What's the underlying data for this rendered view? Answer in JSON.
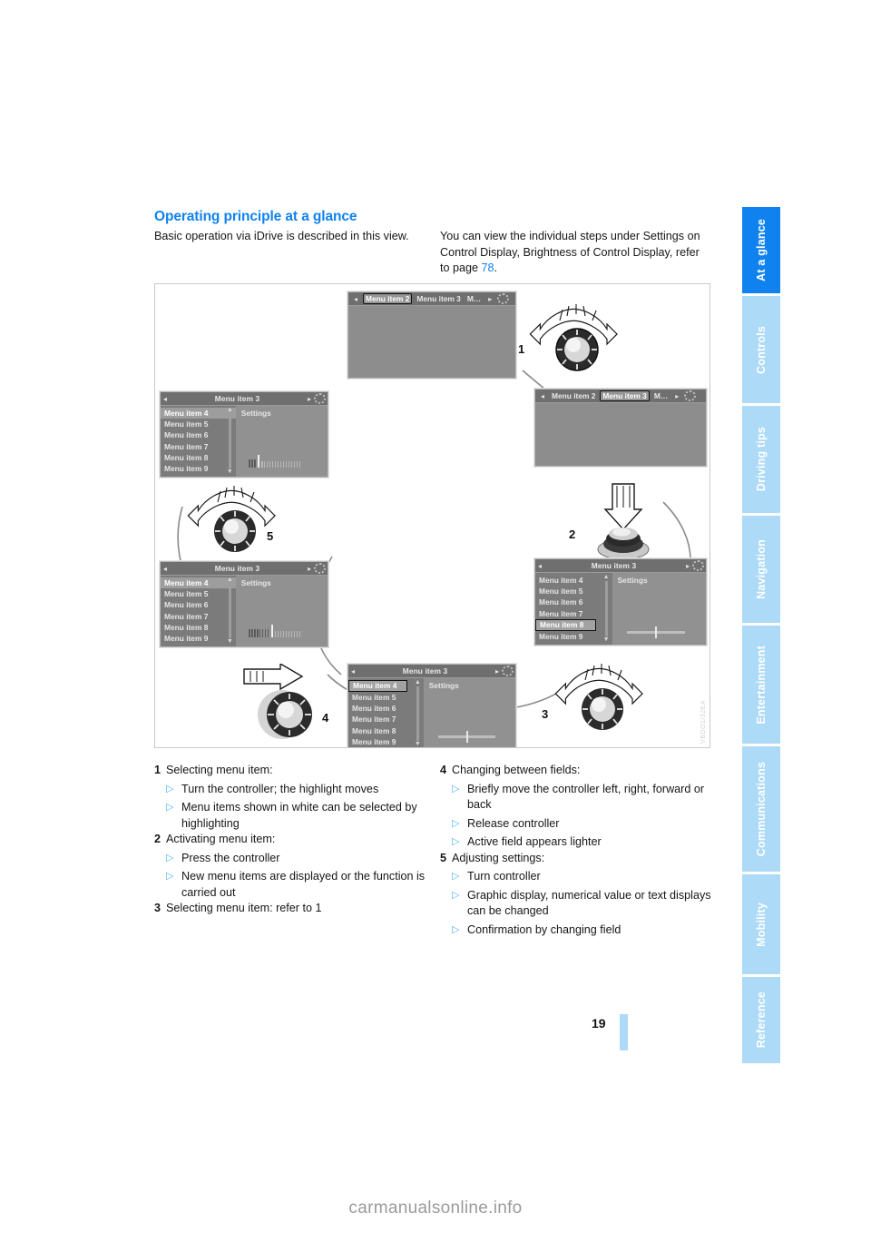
{
  "heading": "Operating principle at a glance",
  "intro": {
    "left": "Basic operation via iDrive is described in this view.",
    "right_before": "You can view the individual steps under Settings on Control Display, Brightness of Control Display, refer to page ",
    "right_page_link": "78",
    "right_after": "."
  },
  "sidebar": {
    "items": [
      {
        "label": "At a glance",
        "active": true
      },
      {
        "label": "Controls",
        "active": false
      },
      {
        "label": "Driving tips",
        "active": false
      },
      {
        "label": "Navigation",
        "active": false
      },
      {
        "label": "Entertainment",
        "active": false
      },
      {
        "label": "Communications",
        "active": false
      },
      {
        "label": "Mobility",
        "active": false
      },
      {
        "label": "Reference",
        "active": false
      }
    ],
    "active_color": "#0f82f0",
    "inactive_color": "#addaf7"
  },
  "figure": {
    "code": "VBDO1/32EA",
    "screens": {
      "top": {
        "tabs": [
          {
            "label": "Menu item 2",
            "selected": true
          },
          {
            "label": "Menu item 3",
            "selected": false
          },
          {
            "label": "M…",
            "selected": false
          }
        ],
        "left_arrow": "◂",
        "right_arrow": "▸"
      },
      "mid_right": {
        "tabs": [
          {
            "label": "Menu item 2",
            "selected": false
          },
          {
            "label": "Menu item 3",
            "selected": true
          },
          {
            "label": "M…",
            "selected": false
          }
        ],
        "left_arrow": "◂",
        "right_arrow": "▸"
      },
      "mid_left": {
        "title": "Menu item 3",
        "left_arrow": "◂",
        "right_arrow": "▸",
        "settings_label": "Settings",
        "items": [
          {
            "label": "Menu item 4",
            "state": "highlight"
          },
          {
            "label": "Menu item 5",
            "state": "normal"
          },
          {
            "label": "Menu item 6",
            "state": "normal"
          },
          {
            "label": "Menu item 7",
            "state": "normal"
          },
          {
            "label": "Menu item 8",
            "state": "normal"
          },
          {
            "label": "Menu item 9",
            "state": "normal"
          }
        ],
        "control": "bars"
      },
      "bottom_left": {
        "title": "Menu item 3",
        "left_arrow": "◂",
        "right_arrow": "▸",
        "settings_label": "Settings",
        "items": [
          {
            "label": "Menu item 4",
            "state": "highlight"
          },
          {
            "label": "Menu item 5",
            "state": "normal"
          },
          {
            "label": "Menu item 6",
            "state": "normal"
          },
          {
            "label": "Menu item 7",
            "state": "normal"
          },
          {
            "label": "Menu item 8",
            "state": "normal"
          },
          {
            "label": "Menu item 9",
            "state": "normal"
          }
        ],
        "control": "bars-high"
      },
      "bottom_right": {
        "title": "Menu item 3",
        "left_arrow": "◂",
        "right_arrow": "▸",
        "settings_label": "Settings",
        "items": [
          {
            "label": "Menu item 4",
            "state": "normal"
          },
          {
            "label": "Menu item 5",
            "state": "normal"
          },
          {
            "label": "Menu item 6",
            "state": "normal"
          },
          {
            "label": "Menu item 7",
            "state": "normal"
          },
          {
            "label": "Menu item 8",
            "state": "boxed"
          },
          {
            "label": "Menu item 9",
            "state": "normal"
          }
        ],
        "control": "slider"
      },
      "bottom_center": {
        "title": "Menu item 3",
        "left_arrow": "◂",
        "right_arrow": "▸",
        "settings_label": "Settings",
        "items": [
          {
            "label": "Menu item 4",
            "state": "boxed"
          },
          {
            "label": "Menu item 5",
            "state": "normal"
          },
          {
            "label": "Menu item 6",
            "state": "normal"
          },
          {
            "label": "Menu item 7",
            "state": "normal"
          },
          {
            "label": "Menu item 8",
            "state": "normal"
          },
          {
            "label": "Menu item 9",
            "state": "normal"
          }
        ],
        "control": "slider"
      }
    },
    "callouts": [
      {
        "number": "1",
        "action": "turn"
      },
      {
        "number": "2",
        "action": "press"
      },
      {
        "number": "3",
        "action": "turn"
      },
      {
        "number": "4",
        "action": "move-right"
      },
      {
        "number": "5",
        "action": "turn"
      }
    ]
  },
  "steps_left": [
    {
      "num": "1",
      "title": "Selecting menu item:",
      "bullets": [
        "Turn the controller; the highlight moves",
        "Menu items shown in white can be selected by highlighting"
      ]
    },
    {
      "num": "2",
      "title": "Activating menu item:",
      "bullets": [
        "Press the controller",
        "New menu items are displayed or the function is carried out"
      ]
    },
    {
      "num": "3",
      "title": "Selecting menu item: refer to 1",
      "bullets": []
    }
  ],
  "steps_right": [
    {
      "num": "4",
      "title": "Changing between fields:",
      "bullets": [
        "Briefly move the controller left, right, forward or back",
        "Release controller",
        "Active field appears lighter"
      ]
    },
    {
      "num": "5",
      "title": "Adjusting settings:",
      "bullets": [
        "Turn controller",
        "Graphic display, numerical value or text displays can be changed",
        "Confirmation by changing field"
      ]
    }
  ],
  "footer": {
    "page_number": "19",
    "watermark": "carmanualsonline.info"
  },
  "bullet_glyph": "▷"
}
